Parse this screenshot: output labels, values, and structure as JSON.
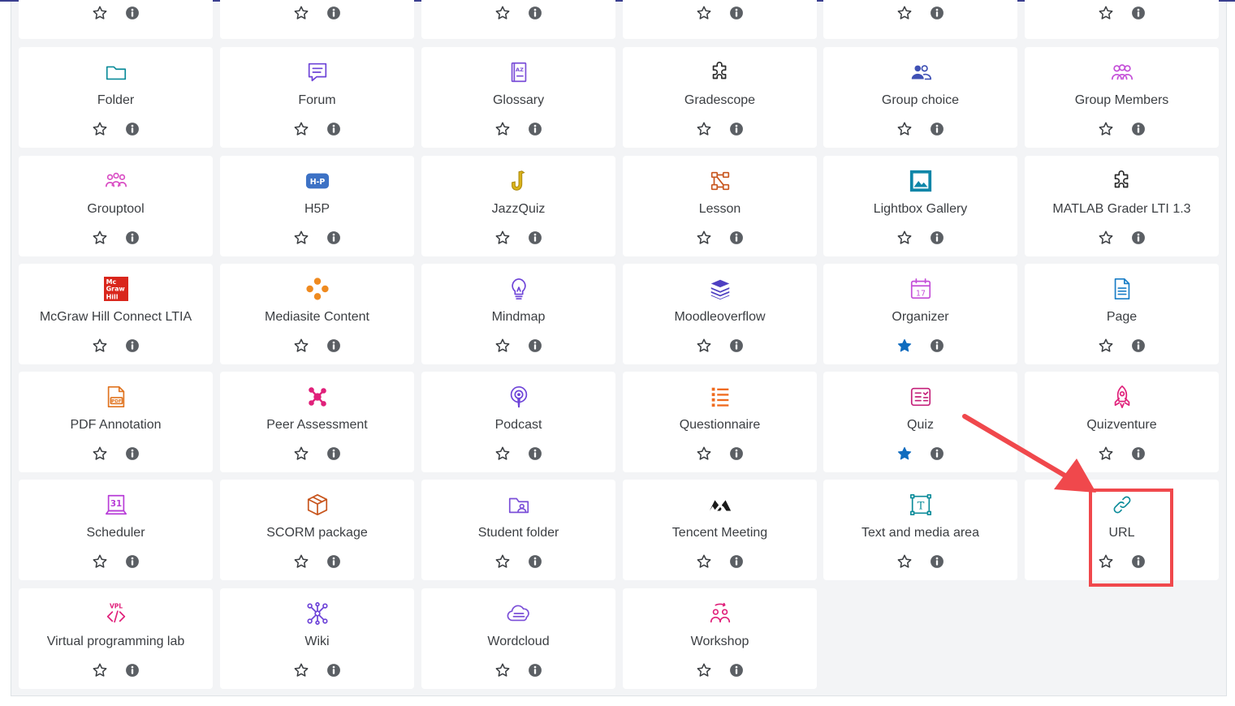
{
  "colors": {
    "panel_bg": "#f3f4f6",
    "card_bg": "#ffffff",
    "label_text": "#3b3e42",
    "star_outline": "#3b3e42",
    "star_filled": "#0f6cbf",
    "info_bg": "#5b5f64",
    "highlight": "#f0484c"
  },
  "activities": [
    {
      "label": "",
      "starred": false,
      "icon": "partial-row"
    },
    {
      "label": "",
      "starred": false,
      "icon": "partial-row"
    },
    {
      "label": "",
      "starred": false,
      "icon": "partial-row"
    },
    {
      "label": "",
      "starred": false,
      "icon": "partial-row"
    },
    {
      "label": "",
      "starred": false,
      "icon": "partial-row"
    },
    {
      "label": "",
      "starred": false,
      "icon": "partial-row"
    },
    {
      "label": "Folder",
      "starred": false,
      "icon": "folder-icon"
    },
    {
      "label": "Forum",
      "starred": false,
      "icon": "forum-icon"
    },
    {
      "label": "Glossary",
      "starred": false,
      "icon": "glossary-icon"
    },
    {
      "label": "Gradescope",
      "starred": false,
      "icon": "puzzle-icon"
    },
    {
      "label": "Group choice",
      "starred": false,
      "icon": "group-choice-icon"
    },
    {
      "label": "Group Members",
      "starred": false,
      "icon": "group-members-icon"
    },
    {
      "label": "Grouptool",
      "starred": false,
      "icon": "grouptool-icon"
    },
    {
      "label": "H5P",
      "starred": false,
      "icon": "h5p-icon"
    },
    {
      "label": "JazzQuiz",
      "starred": false,
      "icon": "saxophone-icon"
    },
    {
      "label": "Lesson",
      "starred": false,
      "icon": "lesson-icon"
    },
    {
      "label": "Lightbox Gallery",
      "starred": false,
      "icon": "gallery-icon"
    },
    {
      "label": "MATLAB Grader LTI 1.3",
      "starred": false,
      "icon": "puzzle-icon"
    },
    {
      "label": "McGraw Hill Connect LTIA",
      "starred": false,
      "icon": "mcgraw-hill-logo-icon"
    },
    {
      "label": "Mediasite Content",
      "starred": false,
      "icon": "mediasite-dots-icon"
    },
    {
      "label": "Mindmap",
      "starred": false,
      "icon": "lightbulb-icon"
    },
    {
      "label": "Moodleoverflow",
      "starred": false,
      "icon": "stack-icon"
    },
    {
      "label": "Organizer",
      "starred": true,
      "icon": "calendar-icon"
    },
    {
      "label": "Page",
      "starred": false,
      "icon": "page-icon"
    },
    {
      "label": "PDF Annotation",
      "starred": false,
      "icon": "pdf-icon"
    },
    {
      "label": "Peer Assessment",
      "starred": false,
      "icon": "peer-assessment-icon"
    },
    {
      "label": "Podcast",
      "starred": false,
      "icon": "podcast-icon"
    },
    {
      "label": "Questionnaire",
      "starred": false,
      "icon": "questionnaire-icon"
    },
    {
      "label": "Quiz",
      "starred": true,
      "icon": "quiz-icon"
    },
    {
      "label": "Quizventure",
      "starred": false,
      "icon": "rocket-icon"
    },
    {
      "label": "Scheduler",
      "starred": false,
      "icon": "scheduler-calendar-icon"
    },
    {
      "label": "SCORM package",
      "starred": false,
      "icon": "package-box-icon"
    },
    {
      "label": "Student folder",
      "starred": false,
      "icon": "student-folder-icon"
    },
    {
      "label": "Tencent Meeting",
      "starred": false,
      "icon": "tencent-meeting-icon"
    },
    {
      "label": "Text and media area",
      "starred": false,
      "icon": "text-media-icon"
    },
    {
      "label": "URL",
      "starred": false,
      "icon": "link-icon"
    },
    {
      "label": "Virtual programming lab",
      "starred": false,
      "icon": "vpl-icon"
    },
    {
      "label": "Wiki",
      "starred": false,
      "icon": "wiki-network-icon"
    },
    {
      "label": "Wordcloud",
      "starred": false,
      "icon": "cloud-icon"
    },
    {
      "label": "Workshop",
      "starred": false,
      "icon": "workshop-icon"
    }
  ],
  "icon_text": {
    "glossary": "AZ",
    "h5p": "H-P",
    "mcgraw": [
      "Mc",
      "Graw",
      "Hill"
    ],
    "organizer_day": "17",
    "scheduler_day": "31",
    "pdf": "PDF",
    "vpl": "VPL",
    "text_media": "T"
  }
}
